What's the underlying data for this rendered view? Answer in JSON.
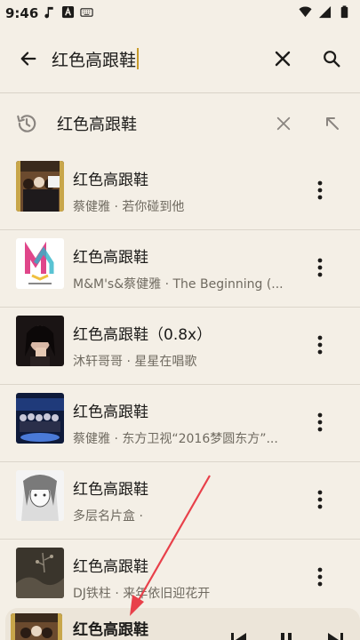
{
  "status": {
    "time": "9:46"
  },
  "search": {
    "query": "红色高跟鞋"
  },
  "history": {
    "text": "红色高跟鞋"
  },
  "results": [
    {
      "title": "红色高跟鞋",
      "subtitle": "蔡健雅 · 若你碰到他"
    },
    {
      "title": "红色高跟鞋",
      "subtitle": "M&M's&蔡健雅 · The Beginning (..."
    },
    {
      "title": "红色高跟鞋（0.8x）",
      "subtitle": "沐轩哥哥 · 星星在唱歌"
    },
    {
      "title": "红色高跟鞋",
      "subtitle": "蔡健雅 · 东方卫视“2016梦圆东方”..."
    },
    {
      "title": "红色高跟鞋",
      "subtitle": "多层名片盒 ·"
    },
    {
      "title": "红色高跟鞋",
      "subtitle": "DJ铁柱 · 来年依旧迎花开"
    }
  ],
  "player": {
    "title": "红色高跟鞋"
  },
  "colors": {
    "background": "#f4efe6",
    "accent_caret": "#c89b2a",
    "annotation_arrow": "#e8404a"
  },
  "icons": [
    "back-arrow-icon",
    "clear-icon",
    "search-icon",
    "history-icon",
    "fill-query-icon",
    "more-vert-icon",
    "skip-previous-icon",
    "pause-icon",
    "skip-next-icon"
  ]
}
